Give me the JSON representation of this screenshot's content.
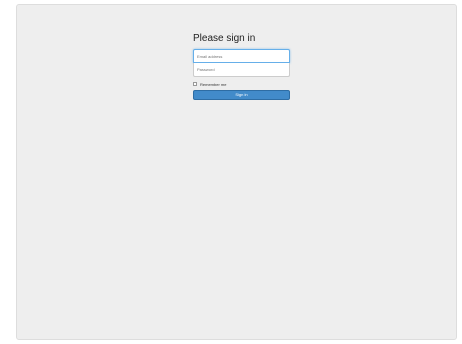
{
  "signin": {
    "title": "Please sign in",
    "email_placeholder": "Email address",
    "password_placeholder": "Password",
    "remember_label": "Remember me",
    "submit_label": "Sign in"
  },
  "colors": {
    "background": "#eeeeee",
    "primary_button": "#428bca",
    "focus_border": "#66afe9"
  }
}
